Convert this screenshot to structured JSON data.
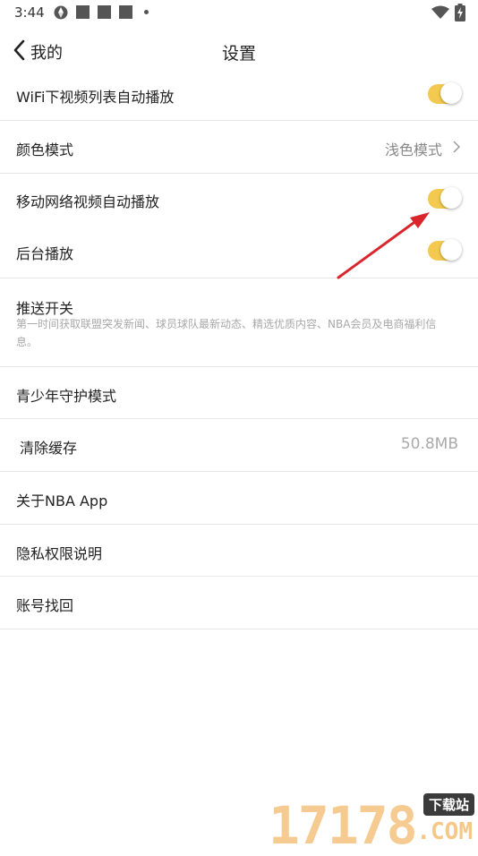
{
  "status_bar": {
    "time": "3:44",
    "icons": [
      "sync-icon",
      "notification-icon",
      "notification-icon",
      "notification-icon",
      "more-dot-icon",
      "wifi-icon",
      "battery-charging-icon"
    ]
  },
  "header": {
    "back_label": "我的",
    "title": "设置"
  },
  "settings": {
    "wifi_autoplay": {
      "label": "WiFi下视频列表自动播放",
      "enabled": true
    },
    "color_mode": {
      "label": "颜色模式",
      "value": "浅色模式"
    },
    "mobile_autoplay": {
      "label": "移动网络视频自动播放",
      "enabled": true
    },
    "background_play": {
      "label": "后台播放",
      "enabled": true
    },
    "push": {
      "label": "推送开关",
      "desc": "第一时间获取联盟突发新闻、球员球队最新动态、精选优质内容、NBA会员及电商福利信息。"
    },
    "teen_mode": {
      "label": "青少年守护模式"
    },
    "clear_cache": {
      "label": "清除缓存",
      "value": "50.8MB"
    },
    "about": {
      "label": "关于NBA App"
    },
    "privacy": {
      "label": "隐私权限说明"
    },
    "account": {
      "label": "账号找回"
    }
  },
  "watermark": {
    "digits": "17178",
    "badge": "下载站",
    "domain": ".COM"
  },
  "colors": {
    "toggle_on": "#f3c94f",
    "annotation_arrow": "#d9262c",
    "divider": "#e8e8e8"
  }
}
